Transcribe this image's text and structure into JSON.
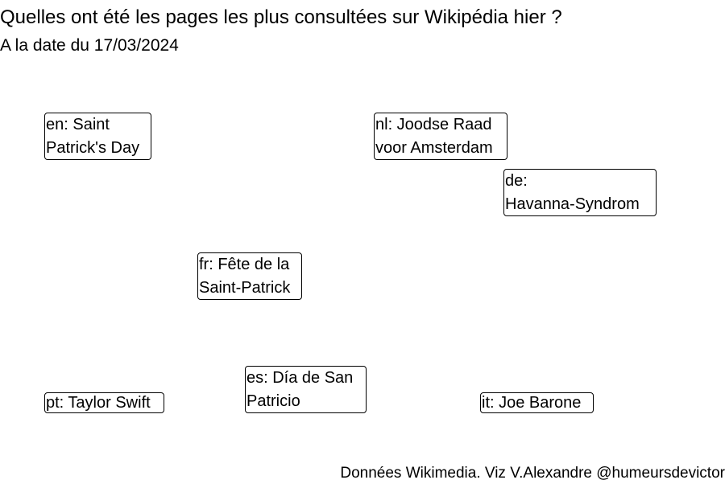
{
  "header": {
    "title": "Quelles ont été les pages les plus consultées sur Wikipédia hier ?",
    "subtitle": "A la date du 17/03/2024"
  },
  "footer": {
    "caption": "Données Wikimedia. Viz V.Alexandre @humeursdevictor"
  },
  "chart_data": {
    "type": "text-labels",
    "title": "Quelles ont été les pages les plus consultées sur Wikipédia hier ?",
    "subtitle": "A la date du 17/03/2024",
    "caption": "Données Wikimedia. Viz V.Alexandre @humeursdevictor",
    "labels": [
      {
        "lang": "en",
        "text": "en: Saint Patrick's Day",
        "lines": [
          "en: Saint",
          "Patrick's Day"
        ]
      },
      {
        "lang": "nl",
        "text": "nl: Joodse Raad voor Amsterdam",
        "lines": [
          "nl: Joodse Raad",
          "voor Amsterdam"
        ]
      },
      {
        "lang": "de",
        "text": "de: Havanna-Syndrom",
        "lines": [
          "de:",
          "Havanna-Syndrom"
        ]
      },
      {
        "lang": "fr",
        "text": "fr: Fête de la Saint-Patrick",
        "lines": [
          "fr: Fête de la",
          "Saint-Patrick"
        ]
      },
      {
        "lang": "es",
        "text": "es: Día de San Patricio",
        "lines": [
          "es: Día de San",
          "Patricio"
        ]
      },
      {
        "lang": "pt",
        "text": "pt: Taylor Swift",
        "lines": [
          "pt: Taylor Swift"
        ]
      },
      {
        "lang": "it",
        "text": "it: Joe Barone",
        "lines": [
          "it: Joe Barone"
        ]
      }
    ]
  }
}
